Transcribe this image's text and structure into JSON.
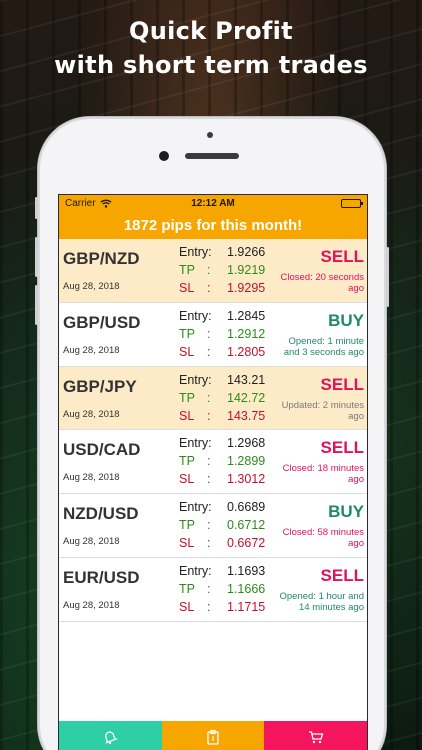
{
  "headline": {
    "line1": "Quick Profit",
    "line2": "with short term trades"
  },
  "status_bar": {
    "carrier": "Carrier",
    "time": "12:12 AM",
    "wifi_icon": "wifi-icon",
    "battery_icon": "battery-icon"
  },
  "banner": "1872 pips for this month!",
  "labels": {
    "entry": "Entry:",
    "tp": "TP",
    "sl": "SL",
    "colon": ":"
  },
  "trades": [
    {
      "pair": "GBP/NZD",
      "date": "Aug 28, 2018",
      "entry": "1.9266",
      "tp": "1.9219",
      "sl": "1.9295",
      "side": "SELL",
      "note": "Closed: 20 seconds ago",
      "note_type": "closed",
      "highlight": true
    },
    {
      "pair": "GBP/USD",
      "date": "Aug 28, 2018",
      "entry": "1.2845",
      "tp": "1.2912",
      "sl": "1.2805",
      "side": "BUY",
      "note": "Opened: 1 minute and 3 seconds ago",
      "note_type": "opened",
      "highlight": false
    },
    {
      "pair": "GBP/JPY",
      "date": "Aug 28, 2018",
      "entry": "143.21",
      "tp": "142.72",
      "sl": "143.75",
      "side": "SELL",
      "note": "Updated: 2 minutes ago",
      "note_type": "updated",
      "highlight": true
    },
    {
      "pair": "USD/CAD",
      "date": "Aug 28, 2018",
      "entry": "1.2968",
      "tp": "1.2899",
      "sl": "1.3012",
      "side": "SELL",
      "note": "Closed: 18 minutes ago",
      "note_type": "closed",
      "highlight": false
    },
    {
      "pair": "NZD/USD",
      "date": "Aug 28, 2018",
      "entry": "0.6689",
      "tp": "0.6712",
      "sl": "0.6672",
      "side": "BUY",
      "note": "Closed: 58 minutes ago",
      "note_type": "closed",
      "highlight": false
    },
    {
      "pair": "EUR/USD",
      "date": "Aug 28, 2018",
      "entry": "1.1693",
      "tp": "1.1666",
      "sl": "1.1715",
      "side": "SELL",
      "note": "Opened: 1 hour and 14 minutes ago",
      "note_type": "opened",
      "highlight": false
    }
  ],
  "tabs": [
    {
      "label": "Open Alerts",
      "icon": "bell-icon",
      "color": "#2fcfa5",
      "active": true
    },
    {
      "label": "Closed Alerts",
      "icon": "clipboard-icon",
      "color": "#f7a600",
      "active": false
    },
    {
      "label": "Subcription",
      "icon": "cart-icon",
      "color": "#f5155e",
      "active": false
    }
  ],
  "colors": {
    "accent": "#f7a600",
    "sell": "#e0125b",
    "buy": "#1f8a6a",
    "tp": "#2e8b1a",
    "sl": "#c4102e",
    "highlight_row": "#fdebc8"
  }
}
